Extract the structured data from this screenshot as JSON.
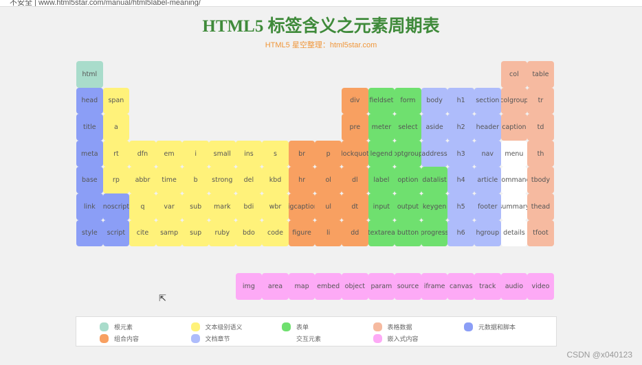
{
  "browser": {
    "url": "不安全 | www.html5star.com/manual/html5label-meaning/"
  },
  "header": {
    "title": "HTML5 标签含义之元素周期表",
    "subtitle": "HTML5 星空整理：html5star.com"
  },
  "categories": {
    "root": {
      "label": "根元素",
      "color": "#a9dccb"
    },
    "text": {
      "label": "文本级别语义",
      "color": "#fff27a"
    },
    "form": {
      "label": "表单",
      "color": "#6fe06f"
    },
    "table": {
      "label": "表格数据",
      "color": "#f6baa0"
    },
    "meta": {
      "label": "元数据和脚本",
      "color": "#8b9ef6"
    },
    "group": {
      "label": "组合内容",
      "color": "#f8a061"
    },
    "section": {
      "label": "文档章节",
      "color": "#aebcfb"
    },
    "interactive": {
      "label": "交互元素",
      "color": "#ffffff"
    },
    "embedded": {
      "label": "嵌入式内容",
      "color": "#fdaaf6"
    }
  },
  "legend_order": [
    "root",
    "text",
    "form",
    "table",
    "meta",
    "group",
    "section",
    "interactive",
    "embedded"
  ],
  "elements": [
    {
      "t": "html",
      "r": 0,
      "c": 0,
      "k": "root"
    },
    {
      "t": "col",
      "r": 0,
      "c": 16,
      "k": "table"
    },
    {
      "t": "table",
      "r": 0,
      "c": 17,
      "k": "table"
    },
    {
      "t": "head",
      "r": 1,
      "c": 0,
      "k": "meta"
    },
    {
      "t": "span",
      "r": 1,
      "c": 1,
      "k": "text"
    },
    {
      "t": "div",
      "r": 1,
      "c": 10,
      "k": "group"
    },
    {
      "t": "fieldset",
      "r": 1,
      "c": 11,
      "k": "form"
    },
    {
      "t": "form",
      "r": 1,
      "c": 12,
      "k": "form"
    },
    {
      "t": "body",
      "r": 1,
      "c": 13,
      "k": "section"
    },
    {
      "t": "h1",
      "r": 1,
      "c": 14,
      "k": "section"
    },
    {
      "t": "section",
      "r": 1,
      "c": 15,
      "k": "section"
    },
    {
      "t": "colgroup",
      "r": 1,
      "c": 16,
      "k": "table"
    },
    {
      "t": "tr",
      "r": 1,
      "c": 17,
      "k": "table"
    },
    {
      "t": "title",
      "r": 2,
      "c": 0,
      "k": "meta"
    },
    {
      "t": "a",
      "r": 2,
      "c": 1,
      "k": "text"
    },
    {
      "t": "pre",
      "r": 2,
      "c": 10,
      "k": "group"
    },
    {
      "t": "meter",
      "r": 2,
      "c": 11,
      "k": "form"
    },
    {
      "t": "select",
      "r": 2,
      "c": 12,
      "k": "form"
    },
    {
      "t": "aside",
      "r": 2,
      "c": 13,
      "k": "section"
    },
    {
      "t": "h2",
      "r": 2,
      "c": 14,
      "k": "section"
    },
    {
      "t": "header",
      "r": 2,
      "c": 15,
      "k": "section"
    },
    {
      "t": "caption",
      "r": 2,
      "c": 16,
      "k": "table"
    },
    {
      "t": "td",
      "r": 2,
      "c": 17,
      "k": "table"
    },
    {
      "t": "meta",
      "r": 3,
      "c": 0,
      "k": "meta"
    },
    {
      "t": "rt",
      "r": 3,
      "c": 1,
      "k": "text"
    },
    {
      "t": "dfn",
      "r": 3,
      "c": 2,
      "k": "text"
    },
    {
      "t": "em",
      "r": 3,
      "c": 3,
      "k": "text"
    },
    {
      "t": "i",
      "r": 3,
      "c": 4,
      "k": "text"
    },
    {
      "t": "small",
      "r": 3,
      "c": 5,
      "k": "text"
    },
    {
      "t": "ins",
      "r": 3,
      "c": 6,
      "k": "text"
    },
    {
      "t": "s",
      "r": 3,
      "c": 7,
      "k": "text"
    },
    {
      "t": "br",
      "r": 3,
      "c": 8,
      "k": "group"
    },
    {
      "t": "p",
      "r": 3,
      "c": 9,
      "k": "group"
    },
    {
      "t": "blockquote",
      "r": 3,
      "c": 10,
      "k": "group"
    },
    {
      "t": "legend",
      "r": 3,
      "c": 11,
      "k": "form"
    },
    {
      "t": "optgroup",
      "r": 3,
      "c": 12,
      "k": "form"
    },
    {
      "t": "address",
      "r": 3,
      "c": 13,
      "k": "section"
    },
    {
      "t": "h3",
      "r": 3,
      "c": 14,
      "k": "section"
    },
    {
      "t": "nav",
      "r": 3,
      "c": 15,
      "k": "section"
    },
    {
      "t": "menu",
      "r": 3,
      "c": 16,
      "k": "interactive"
    },
    {
      "t": "th",
      "r": 3,
      "c": 17,
      "k": "table"
    },
    {
      "t": "base",
      "r": 4,
      "c": 0,
      "k": "meta"
    },
    {
      "t": "rp",
      "r": 4,
      "c": 1,
      "k": "text"
    },
    {
      "t": "abbr",
      "r": 4,
      "c": 2,
      "k": "text"
    },
    {
      "t": "time",
      "r": 4,
      "c": 3,
      "k": "text"
    },
    {
      "t": "b",
      "r": 4,
      "c": 4,
      "k": "text"
    },
    {
      "t": "strong",
      "r": 4,
      "c": 5,
      "k": "text"
    },
    {
      "t": "del",
      "r": 4,
      "c": 6,
      "k": "text"
    },
    {
      "t": "kbd",
      "r": 4,
      "c": 7,
      "k": "text"
    },
    {
      "t": "hr",
      "r": 4,
      "c": 8,
      "k": "group"
    },
    {
      "t": "ol",
      "r": 4,
      "c": 9,
      "k": "group"
    },
    {
      "t": "dl",
      "r": 4,
      "c": 10,
      "k": "group"
    },
    {
      "t": "label",
      "r": 4,
      "c": 11,
      "k": "form"
    },
    {
      "t": "option",
      "r": 4,
      "c": 12,
      "k": "form"
    },
    {
      "t": "datalist",
      "r": 4,
      "c": 13,
      "k": "form"
    },
    {
      "t": "h4",
      "r": 4,
      "c": 14,
      "k": "section"
    },
    {
      "t": "article",
      "r": 4,
      "c": 15,
      "k": "section"
    },
    {
      "t": "command",
      "r": 4,
      "c": 16,
      "k": "interactive"
    },
    {
      "t": "tbody",
      "r": 4,
      "c": 17,
      "k": "table"
    },
    {
      "t": "link",
      "r": 5,
      "c": 0,
      "k": "meta"
    },
    {
      "t": "noscript",
      "r": 5,
      "c": 1,
      "k": "meta"
    },
    {
      "t": "q",
      "r": 5,
      "c": 2,
      "k": "text"
    },
    {
      "t": "var",
      "r": 5,
      "c": 3,
      "k": "text"
    },
    {
      "t": "sub",
      "r": 5,
      "c": 4,
      "k": "text"
    },
    {
      "t": "mark",
      "r": 5,
      "c": 5,
      "k": "text"
    },
    {
      "t": "bdi",
      "r": 5,
      "c": 6,
      "k": "text"
    },
    {
      "t": "wbr",
      "r": 5,
      "c": 7,
      "k": "text"
    },
    {
      "t": "figcaption",
      "r": 5,
      "c": 8,
      "k": "group"
    },
    {
      "t": "ul",
      "r": 5,
      "c": 9,
      "k": "group"
    },
    {
      "t": "dt",
      "r": 5,
      "c": 10,
      "k": "group"
    },
    {
      "t": "input",
      "r": 5,
      "c": 11,
      "k": "form"
    },
    {
      "t": "output",
      "r": 5,
      "c": 12,
      "k": "form"
    },
    {
      "t": "keygen",
      "r": 5,
      "c": 13,
      "k": "form"
    },
    {
      "t": "h5",
      "r": 5,
      "c": 14,
      "k": "section"
    },
    {
      "t": "footer",
      "r": 5,
      "c": 15,
      "k": "section"
    },
    {
      "t": "summary",
      "r": 5,
      "c": 16,
      "k": "interactive"
    },
    {
      "t": "thead",
      "r": 5,
      "c": 17,
      "k": "table"
    },
    {
      "t": "style",
      "r": 6,
      "c": 0,
      "k": "meta"
    },
    {
      "t": "script",
      "r": 6,
      "c": 1,
      "k": "meta"
    },
    {
      "t": "cite",
      "r": 6,
      "c": 2,
      "k": "text"
    },
    {
      "t": "samp",
      "r": 6,
      "c": 3,
      "k": "text"
    },
    {
      "t": "sup",
      "r": 6,
      "c": 4,
      "k": "text"
    },
    {
      "t": "ruby",
      "r": 6,
      "c": 5,
      "k": "text"
    },
    {
      "t": "bdo",
      "r": 6,
      "c": 6,
      "k": "text"
    },
    {
      "t": "code",
      "r": 6,
      "c": 7,
      "k": "text"
    },
    {
      "t": "figure",
      "r": 6,
      "c": 8,
      "k": "group"
    },
    {
      "t": "li",
      "r": 6,
      "c": 9,
      "k": "group"
    },
    {
      "t": "dd",
      "r": 6,
      "c": 10,
      "k": "group"
    },
    {
      "t": "textarea",
      "r": 6,
      "c": 11,
      "k": "form"
    },
    {
      "t": "button",
      "r": 6,
      "c": 12,
      "k": "form"
    },
    {
      "t": "progress",
      "r": 6,
      "c": 13,
      "k": "form"
    },
    {
      "t": "h6",
      "r": 6,
      "c": 14,
      "k": "section"
    },
    {
      "t": "hgroup",
      "r": 6,
      "c": 15,
      "k": "section"
    },
    {
      "t": "details",
      "r": 6,
      "c": 16,
      "k": "interactive"
    },
    {
      "t": "tfoot",
      "r": 6,
      "c": 17,
      "k": "table"
    },
    {
      "t": "img",
      "r": 8,
      "c": 6,
      "k": "embedded"
    },
    {
      "t": "area",
      "r": 8,
      "c": 7,
      "k": "embedded"
    },
    {
      "t": "map",
      "r": 8,
      "c": 8,
      "k": "embedded"
    },
    {
      "t": "embed",
      "r": 8,
      "c": 9,
      "k": "embedded"
    },
    {
      "t": "object",
      "r": 8,
      "c": 10,
      "k": "embedded"
    },
    {
      "t": "param",
      "r": 8,
      "c": 11,
      "k": "embedded"
    },
    {
      "t": "source",
      "r": 8,
      "c": 12,
      "k": "embedded"
    },
    {
      "t": "iframe",
      "r": 8,
      "c": 13,
      "k": "embedded"
    },
    {
      "t": "canvas",
      "r": 8,
      "c": 14,
      "k": "embedded"
    },
    {
      "t": "track",
      "r": 8,
      "c": 15,
      "k": "embedded"
    },
    {
      "t": "audio",
      "r": 8,
      "c": 16,
      "k": "embedded"
    },
    {
      "t": "video",
      "r": 8,
      "c": 17,
      "k": "embedded"
    }
  ],
  "watermark": "CSDN @x040123"
}
